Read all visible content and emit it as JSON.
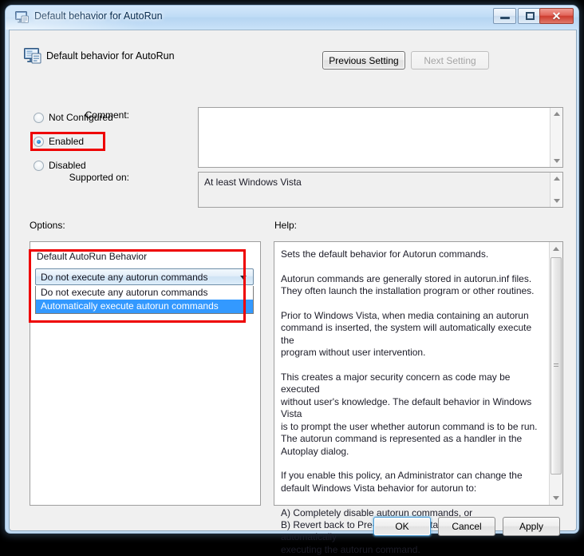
{
  "window": {
    "title": "Default behavior for AutoRun",
    "icon": "policy-setting-icon",
    "controls": {
      "minimize": "Minimize",
      "maximize": "Maximize",
      "close": "Close",
      "close_glyph": "✕"
    }
  },
  "header": {
    "icon": "policy-setting-icon",
    "title": "Default behavior for AutoRun",
    "previous_setting": "Previous Setting",
    "next_setting": "Next Setting"
  },
  "state_options": [
    {
      "label": "Not Configured",
      "checked": false
    },
    {
      "label": "Enabled",
      "checked": true
    },
    {
      "label": "Disabled",
      "checked": false
    }
  ],
  "fields": {
    "comment_label": "Comment:",
    "comment_value": "",
    "supported_on_label": "Supported on:",
    "supported_on_value": "At least Windows Vista"
  },
  "panels": {
    "options_label": "Options:",
    "help_label": "Help:"
  },
  "options": {
    "group_label": "Default AutoRun Behavior",
    "selected_value": "Do not execute any autorun commands",
    "dropdown_open": true,
    "items": [
      {
        "label": "Do not execute any autorun commands",
        "selected": false
      },
      {
        "label": "Automatically execute autorun commands",
        "selected": true
      }
    ]
  },
  "help": {
    "text": "Sets the default behavior for Autorun commands.\n\nAutorun commands are generally stored in autorun.inf files.\nThey often launch the installation program or other routines.\n\nPrior to Windows Vista, when media containing an autorun\ncommand is inserted, the system will automatically execute the\nprogram without user intervention.\n\nThis creates a major security concern as code may be executed\nwithout user's knowledge. The default behavior in Windows Vista\nis to prompt the user whether autorun command is to be run.\nThe autorun command is represented as a handler in the\nAutoplay dialog.\n\nIf you enable this policy, an Administrator can change the\ndefault Windows Vista behavior for autorun to:\n\nA) Completely disable autorun commands, or\nB) Revert back to Pre-Windows Vista behavior of automatically\nexecuting the autorun command."
  },
  "buttons": {
    "ok": "OK",
    "cancel": "Cancel",
    "apply": "Apply"
  },
  "annotations": {
    "color": "#ee0000",
    "highlight_enabled": "Enabled",
    "highlight_dropdown": "Default AutoRun Behavior dropdown"
  }
}
